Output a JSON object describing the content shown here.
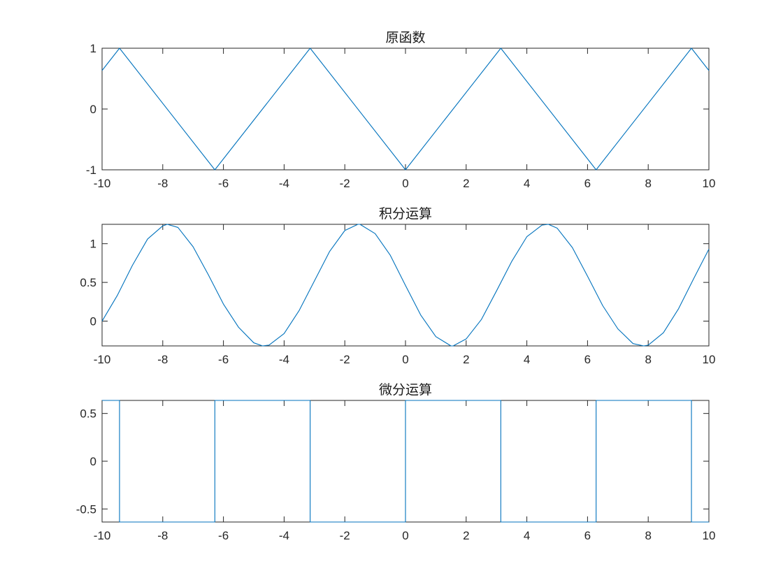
{
  "figure": {
    "background": "#ffffff",
    "line_color": "#0072BD"
  },
  "chart_data": [
    {
      "type": "line",
      "title": "原函数",
      "xlabel": "",
      "ylabel": "",
      "xlim": [
        -10,
        10
      ],
      "ylim": [
        -1,
        1
      ],
      "xticks": [
        -10,
        -8,
        -6,
        -4,
        -2,
        0,
        2,
        4,
        6,
        8,
        10
      ],
      "yticks": [
        -1,
        0,
        1
      ],
      "ytick_labels": [
        "-1",
        "0",
        "1"
      ],
      "grid": false,
      "series": [
        {
          "x": [
            -10,
            -9.4248,
            -6.2832,
            -3.1416,
            0,
            3.1416,
            6.2832,
            9.4248,
            10
          ],
          "y": [
            0.6338,
            1,
            -1,
            1,
            -1,
            1,
            -1,
            1,
            0.6338
          ]
        }
      ]
    },
    {
      "type": "line",
      "title": "积分运算",
      "xlabel": "",
      "ylabel": "",
      "xlim": [
        -10,
        10
      ],
      "ylim": [
        -0.32,
        1.25
      ],
      "xticks": [
        -10,
        -8,
        -6,
        -4,
        -2,
        0,
        2,
        4,
        6,
        8,
        10
      ],
      "yticks": [
        0,
        0.5,
        1
      ],
      "ytick_labels": [
        "0",
        "0.5",
        "1"
      ],
      "grid": false,
      "series": [
        {
          "x": [
            -10,
            -9.5,
            -9,
            -8.5,
            -8,
            -7.85,
            -7.5,
            -7,
            -6.5,
            -6,
            -5.5,
            -5,
            -4.71,
            -4.5,
            -4,
            -3.5,
            -3,
            -2.5,
            -2,
            -1.57,
            -1.5,
            -1,
            -0.5,
            0,
            0.5,
            1,
            1.5,
            1.57,
            2,
            2.5,
            3,
            3.5,
            4,
            4.5,
            4.71,
            5,
            5.5,
            6,
            6.5,
            7,
            7.5,
            7.85,
            8,
            8.5,
            9,
            9.5,
            10
          ],
          "y": [
            0,
            0.33,
            0.72,
            1.06,
            1.23,
            1.25,
            1.21,
            0.96,
            0.6,
            0.22,
            -0.08,
            -0.28,
            -0.32,
            -0.31,
            -0.16,
            0.14,
            0.52,
            0.9,
            1.17,
            1.25,
            1.25,
            1.13,
            0.85,
            0.46,
            0.08,
            -0.2,
            -0.32,
            -0.32,
            -0.23,
            0.02,
            0.39,
            0.77,
            1.09,
            1.24,
            1.25,
            1.2,
            0.95,
            0.58,
            0.2,
            -0.1,
            -0.29,
            -0.32,
            -0.31,
            -0.15,
            0.16,
            0.55,
            0.93
          ]
        }
      ]
    },
    {
      "type": "line",
      "title": "微分运算",
      "xlabel": "",
      "ylabel": "",
      "xlim": [
        -10,
        10
      ],
      "ylim": [
        -0.6366,
        0.6366
      ],
      "xticks": [
        -10,
        -8,
        -6,
        -4,
        -2,
        0,
        2,
        4,
        6,
        8,
        10
      ],
      "yticks": [
        -0.5,
        0,
        0.5
      ],
      "ytick_labels": [
        "-0.5",
        "0",
        "0.5"
      ],
      "grid": false,
      "series": [
        {
          "x": [
            -10,
            -9.4248,
            -9.4248,
            -6.2832,
            -6.2832,
            -3.1416,
            -3.1416,
            0,
            0,
            3.1416,
            3.1416,
            6.2832,
            6.2832,
            9.4248,
            9.4248,
            10
          ],
          "y": [
            0.6366,
            0.6366,
            -0.6366,
            -0.6366,
            0.6366,
            0.6366,
            -0.6366,
            -0.6366,
            0.6366,
            0.6366,
            -0.6366,
            -0.6366,
            0.6366,
            0.6366,
            -0.6366,
            -0.6366
          ]
        }
      ]
    }
  ]
}
